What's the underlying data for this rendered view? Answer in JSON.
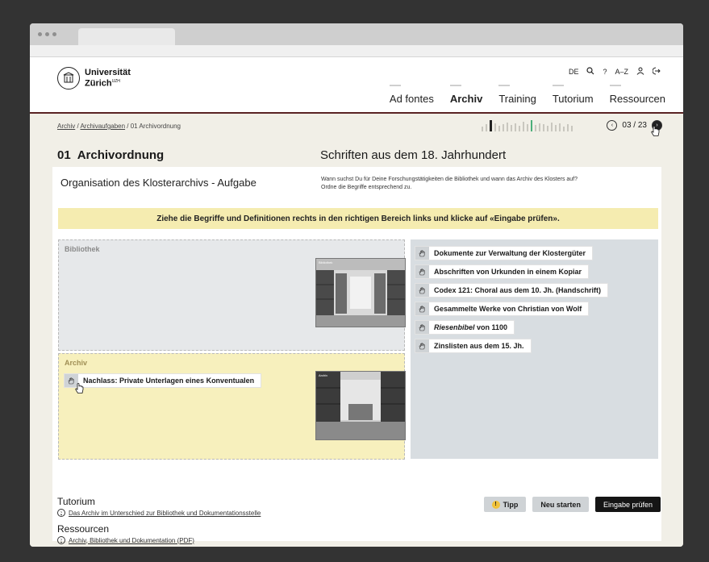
{
  "header": {
    "logo_line1": "Universität",
    "logo_line2": "Zürich",
    "logo_suffix": "UZH",
    "lang": "DE",
    "search_icon": "search-icon",
    "help": "?",
    "az": "A–Z",
    "nav": [
      {
        "label": "Ad fontes",
        "active": false
      },
      {
        "label": "Archiv",
        "active": true
      },
      {
        "label": "Training",
        "active": false
      },
      {
        "label": "Tutorium",
        "active": false
      },
      {
        "label": "Ressourcen",
        "active": false
      }
    ]
  },
  "breadcrumb": {
    "item1": "Archiv",
    "item2": "Archivaufgaben",
    "item3": "01 Archivordnung",
    "sep": " / "
  },
  "pager": {
    "current": "03 / 23"
  },
  "page": {
    "number": "01",
    "title": "Archivordnung",
    "subtitle": "Schriften aus dem 18. Jahrhundert"
  },
  "task": {
    "title": "Organisation des Klosterarchivs - Aufgabe",
    "description": "Wann suchst Du für Deine Forschungstätigkeiten die Bibliothek und wann das Archiv des Klosters auf? Ordne die Begriffe entsprechend zu.",
    "instruction": "Ziehe die Begriffe und Definitionen rechts in den richtigen Bereich links und klicke auf «Eingabe prüfen»."
  },
  "zones": {
    "library_label": "Bibliothek",
    "archive_label": "Archiv",
    "library_photo_caption": "Bibliothek",
    "archive_photo_caption": "Archiv"
  },
  "archive_cards": [
    {
      "label": "Nachlass: Private Unterlagen eines Konventualen"
    }
  ],
  "pool_cards": [
    {
      "label": "Dokumente zur Verwaltung der Klostergüter"
    },
    {
      "label": "Abschriften von Urkunden in einem Kopiar"
    },
    {
      "label": "Codex 121: Choral aus dem 10. Jh. (Handschrift)"
    },
    {
      "label": "Gesammelte Werke von Christian von Wolf"
    },
    {
      "label_em": "Riesenbibel",
      "label_rest": " von 1100"
    },
    {
      "label": "Zinslisten aus dem 15. Jh."
    }
  ],
  "buttons": {
    "tipp": "Tipp",
    "tipp_icon": "!",
    "restart": "Neu starten",
    "check": "Eingabe prüfen"
  },
  "tutorium": {
    "heading": "Tutorium",
    "link": "Das Archiv im Unterschied zur Bibliothek und Dokumentationsstelle"
  },
  "ressourcen": {
    "heading": "Ressourcen",
    "link": "Archiv, Bibliothek und Dokumentation (PDF)"
  },
  "colors": {
    "accent_rule": "#5a2323",
    "instruction_bg": "#f5ecb0",
    "archive_zone_bg": "#f7f0bd",
    "library_zone_bg": "#e6e8ea",
    "pool_bg": "#d8dde1",
    "progress_active": "#222222",
    "progress_done": "#4caf7a"
  }
}
